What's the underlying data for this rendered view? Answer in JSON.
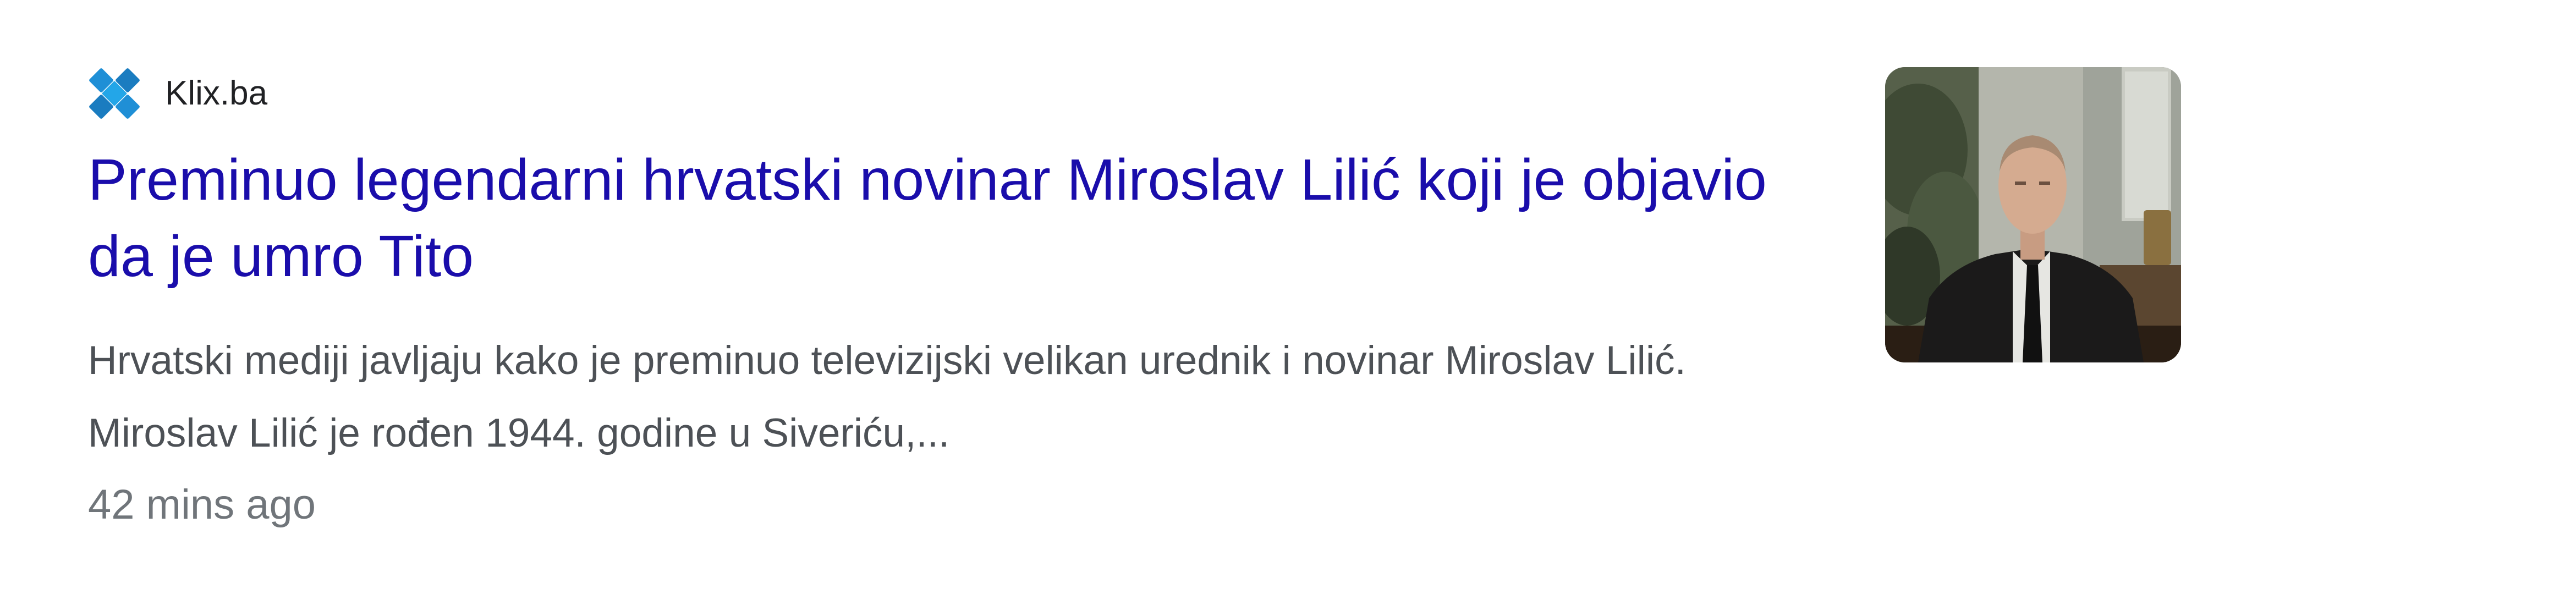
{
  "result": {
    "source": {
      "name": "Klix.ba",
      "logo_icon": "klix-logo-icon",
      "logo_color": "#1b8ed3"
    },
    "headline": "Preminuo legendarni hrvatski novinar Miroslav Lilić koji je objavio da je umro Tito",
    "snippet": "Hrvatski mediji javljaju kako je preminuo televizijski velikan urednik i novinar Miroslav Lilić. Miroslav Lilić je rođen 1944. godine u Siveriću,...",
    "timestamp": "42 mins ago",
    "thumbnail_icon": "news-thumbnail-image",
    "colors": {
      "headline": "#1a0dab",
      "snippet": "#4d5156",
      "timestamp": "#70757a",
      "source": "#202124"
    }
  }
}
